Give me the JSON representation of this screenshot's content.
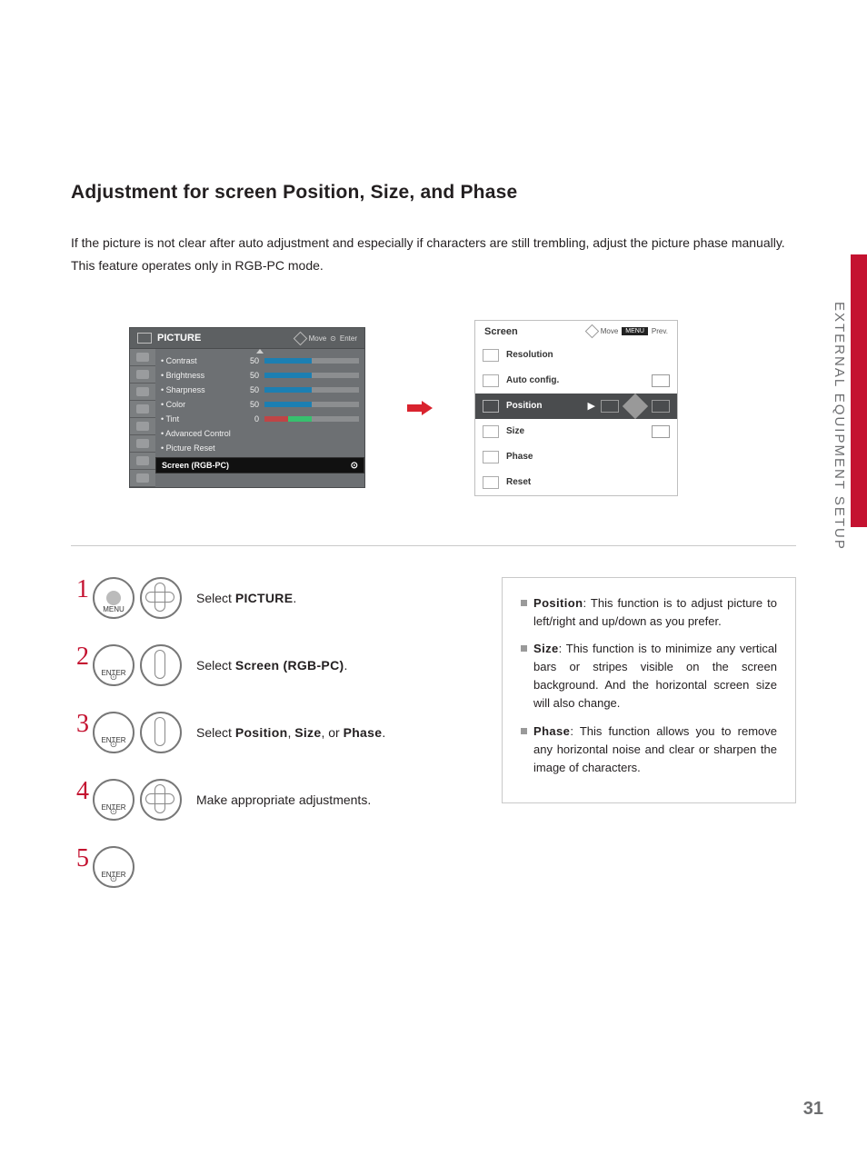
{
  "title": "Adjustment for screen Position, Size, and Phase",
  "intro_line1": "If the picture is not clear after auto adjustment and especially if characters are still trembling, adjust the picture phase manually.",
  "intro_line2": "This feature operates only in RGB-PC mode.",
  "side_label": "EXTERNAL EQUIPMENT SETUP",
  "page_number": "31",
  "picture_menu": {
    "title": "PICTURE",
    "nav_move": "Move",
    "nav_enter": "Enter",
    "rows": [
      {
        "label": "• Contrast",
        "value": "50"
      },
      {
        "label": "• Brightness",
        "value": "50"
      },
      {
        "label": "• Sharpness",
        "value": "50"
      },
      {
        "label": "• Color",
        "value": "50"
      },
      {
        "label": "• Tint",
        "value": "0"
      },
      {
        "label": "• Advanced Control",
        "value": ""
      },
      {
        "label": "• Picture Reset",
        "value": ""
      }
    ],
    "selected": "Screen (RGB-PC)"
  },
  "screen_menu": {
    "title": "Screen",
    "nav_move": "Move",
    "nav_prev": "Prev.",
    "nav_menu_btn": "MENU",
    "items": [
      "Resolution",
      "Auto config.",
      "Position",
      "Size",
      "Phase",
      "Reset"
    ],
    "selected_index": 2
  },
  "steps": [
    {
      "num": "1",
      "btn": "MENU",
      "pad": "quad",
      "pre": "Select ",
      "bold": "PICTURE",
      "post": "."
    },
    {
      "num": "2",
      "btn": "ENTER",
      "pad": "ud",
      "pre": "Select ",
      "bold": "Screen (RGB-PC)",
      "post": "."
    },
    {
      "num": "3",
      "btn": "ENTER",
      "pad": "ud",
      "pre": "Select ",
      "bold": "Position",
      "mid": ", ",
      "bold2": "Size",
      "mid2": ", or ",
      "bold3": "Phase",
      "post": "."
    },
    {
      "num": "4",
      "btn": "ENTER",
      "pad": "quad",
      "pre": "Make appropriate adjustments.",
      "bold": "",
      "post": ""
    },
    {
      "num": "5",
      "btn": "ENTER",
      "pad": "",
      "pre": "",
      "bold": "",
      "post": ""
    }
  ],
  "info": [
    {
      "term": "Position",
      "text": ": This function is to adjust picture to left/right and up/down as you prefer."
    },
    {
      "term": "Size",
      "text": ": This function is to minimize any vertical bars or stripes visible on the screen background. And the horizontal screen size will also change."
    },
    {
      "term": "Phase",
      "text": ": This function allows you to remove any horizontal noise and clear or sharpen the image of characters."
    }
  ]
}
